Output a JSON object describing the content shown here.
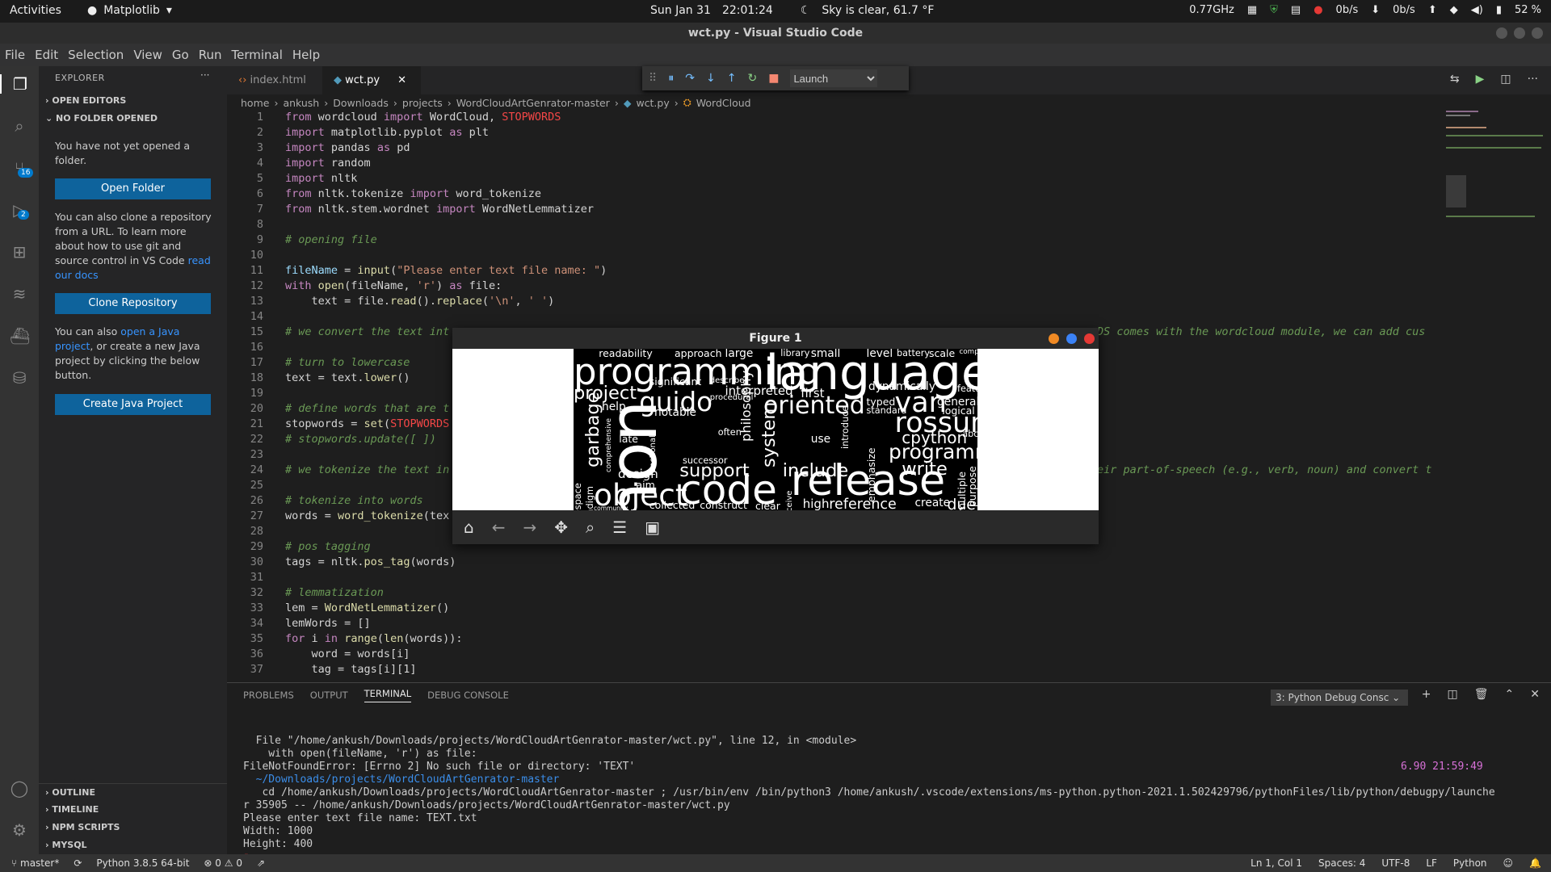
{
  "topbar": {
    "activities": "Activities",
    "app": "Matplotlib",
    "date": "Sun Jan 31",
    "time": "22:01:24",
    "weather": "Sky is clear, 61.7 °F",
    "cpu": "0.77GHz",
    "net_down": "0b/s",
    "net_up": "0b/s",
    "battery": "52 %"
  },
  "window": {
    "title": "wct.py - Visual Studio Code"
  },
  "menu": [
    "File",
    "Edit",
    "Selection",
    "View",
    "Go",
    "Run",
    "Terminal",
    "Help"
  ],
  "activity": {
    "scm_badge": "16",
    "debug_badge": "2"
  },
  "sidebar": {
    "title": "EXPLORER",
    "open_editors": "OPEN EDITORS",
    "no_folder": "NO FOLDER OPENED",
    "msg1": "You have not yet opened a folder.",
    "open_folder": "Open Folder",
    "msg2": "You can also clone a repository from a URL. To learn more about how to use git and source control in VS Code",
    "msg2_link": "read our docs",
    "clone": "Clone Repository",
    "msg3_a": "You can also",
    "msg3_link": "open a Java project",
    "msg3_b": ", or create a new Java project by clicking the below button.",
    "create_java": "Create Java Project",
    "outline": "OUTLINE",
    "timeline": "TIMELINE",
    "npm": "NPM SCRIPTS",
    "mysql": "MYSQL"
  },
  "tabs": [
    {
      "label": "index.html"
    },
    {
      "label": "wct.py"
    }
  ],
  "debug": {
    "config": "Launch"
  },
  "breadcrumbs": [
    "home",
    "ankush",
    "Downloads",
    "projects",
    "WordCloudArtGenrator-master",
    "wct.py",
    "WordCloud"
  ],
  "editor": {
    "lines": [
      "1",
      "2",
      "3",
      "4",
      "5",
      "6",
      "7",
      "8",
      "9",
      "10",
      "11",
      "12",
      "13",
      "14",
      "15",
      "16",
      "17",
      "18",
      "19",
      "20",
      "21",
      "22",
      "23",
      "24",
      "25",
      "26",
      "27",
      "28",
      "29",
      "30",
      "31",
      "32",
      "33",
      "34",
      "35",
      "36",
      "37"
    ],
    "tail15": "DS comes with the wordcloud module, we can add cus",
    "tail24": "eir part-of-speech (e.g., verb, noun) and convert t"
  },
  "figure": {
    "title": "Figure 1",
    "words": [
      "python",
      "programming",
      "language",
      "release",
      "code",
      "object",
      "rossum",
      "guido",
      "oriented",
      "van",
      "project",
      "programmer",
      "cpython",
      "support",
      "include",
      "write",
      "garbage",
      "system",
      "philosophy",
      "reference",
      "high",
      "due",
      "create",
      "dynamically",
      "first",
      "interpreted",
      "significant",
      "readability",
      "approach",
      "large",
      "level",
      "small",
      "library",
      "battery",
      "scale",
      "help",
      "notable",
      "typed",
      "standard",
      "general",
      "logical",
      "design",
      "aim",
      "successor",
      "often",
      "late",
      "use",
      "introduce",
      "emphasize",
      "multiple",
      "purpose",
      "whitespace",
      "paradigm",
      "collected",
      "construct",
      "clear",
      "conceive",
      "feature",
      "describe",
      "procedural",
      "functional",
      "comprehensive",
      "community",
      "abc",
      "compatible"
    ]
  },
  "panel": {
    "tabs": [
      "PROBLEMS",
      "OUTPUT",
      "TERMINAL",
      "DEBUG CONSOLE"
    ],
    "dropdown": "3: Python Debug Consc",
    "terminal": [
      "  File \"/home/ankush/Downloads/projects/WordCloudArtGenrator-master/wct.py\", line 12, in <module>",
      "    with open(fileName, 'r') as file:",
      "FileNotFoundError: [Errno 2] No such file or directory: 'TEXT'",
      "  ~/Downloads/projects/WordCloudArtGenrator-master",
      "   cd /home/ankush/Downloads/projects/WordCloudArtGenrator-master ; /usr/bin/env /bin/python3 /home/ankush/.vscode/extensions/ms-python.python-2021.1.502429796/pythonFiles/lib/python/debugpy/launche",
      "r 35905 -- /home/ankush/Downloads/projects/WordCloudArtGenrator-master/wct.py",
      "Please enter text file name: TEXT.txt",
      "Width: 1000",
      "Height: 400"
    ],
    "prompt_right": "6.90   21:59:49"
  },
  "status": {
    "branch": "master*",
    "python": "Python 3.8.5 64-bit",
    "errors": "0",
    "warnings": "0",
    "position": "Ln 1, Col 1",
    "spaces": "Spaces: 4",
    "encoding": "UTF-8",
    "eol": "LF",
    "lang": "Python"
  },
  "colors": {
    "accent": "#007acc",
    "button": "#0e639c",
    "keyword": "#c586c0",
    "string": "#ce9178",
    "comment": "#6a9955",
    "function": "#dcdcaa"
  }
}
